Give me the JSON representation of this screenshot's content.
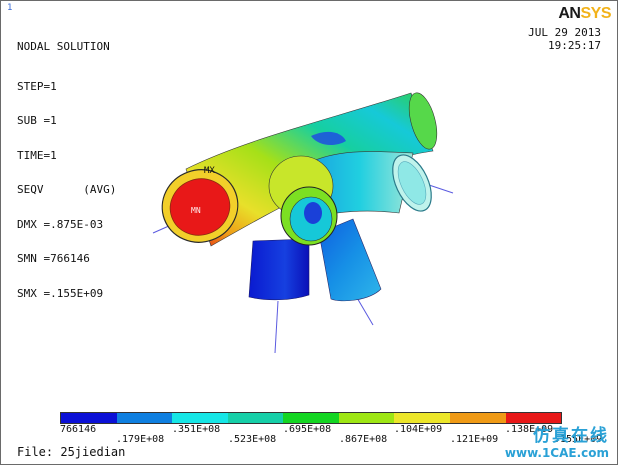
{
  "window_id": "1",
  "title": "NODAL SOLUTION",
  "info_lines": [
    "STEP=1",
    "SUB =1",
    "TIME=1",
    "SEQV      (AVG)",
    "DMX =.875E-03",
    "SMN =766146",
    "SMX =.155E+09"
  ],
  "brand": {
    "part1": "AN",
    "part2": "SYS"
  },
  "date": "JUL 29 2013",
  "time": "19:25:17",
  "markers": {
    "max": "MX",
    "min": "MN"
  },
  "legend": {
    "colors": [
      "#0b10d6",
      "#0f7fe0",
      "#16e6e6",
      "#16cfa8",
      "#14d622",
      "#9ee614",
      "#ece62a",
      "#ef9a16",
      "#e81818"
    ],
    "top_labels": [
      "766146",
      ".351E+08",
      ".695E+08",
      ".104E+09",
      ".138E+09"
    ],
    "bottom_labels": [
      ".179E+08",
      ".523E+08",
      ".867E+08",
      ".121E+09",
      ".155E+09"
    ]
  },
  "file_label": "File: 25jiedian",
  "watermark": {
    "cn": "仿真在线",
    "url": "www.1CAE.com"
  }
}
